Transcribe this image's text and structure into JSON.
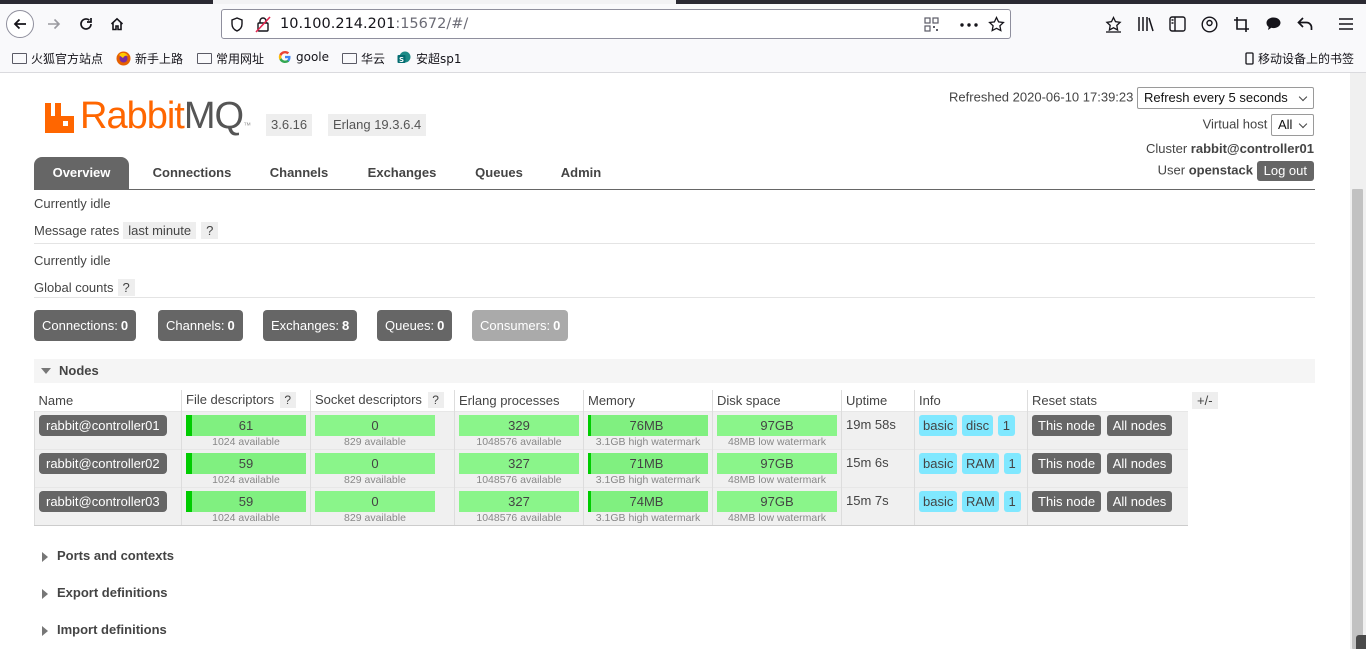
{
  "browser": {
    "url_host": "10.100.214.201",
    "url_rest": ":15672/#/",
    "bookmarks": [
      {
        "label": "火狐官方站点",
        "icon": "folder-icon"
      },
      {
        "label": "新手上路",
        "icon": "firefox-icon"
      },
      {
        "label": "常用网址",
        "icon": "folder-icon"
      },
      {
        "label": "goole",
        "icon": "google-icon"
      },
      {
        "label": "华云",
        "icon": "folder-icon"
      },
      {
        "label": "安超sp1",
        "icon": "sharepoint-icon"
      }
    ],
    "mobile_bookmarks": "移动设备上的书签"
  },
  "header": {
    "logo_rabbit": "Rabbit",
    "logo_mq": "MQ",
    "logo_tm": "™",
    "version": "3.6.16",
    "erlang": "Erlang 19.3.6.4",
    "refreshed_label": "Refreshed",
    "refreshed_value": "2020-06-10 17:39:23",
    "refresh_select": "Refresh every 5 seconds",
    "vhost_label": "Virtual host",
    "vhost_value": "All",
    "cluster_label": "Cluster",
    "cluster_value": "rabbit@controller01",
    "user_label": "User",
    "user_value": "openstack",
    "logout": "Log out"
  },
  "tabs": [
    "Overview",
    "Connections",
    "Channels",
    "Exchanges",
    "Queues",
    "Admin"
  ],
  "overview": {
    "idle1": "Currently idle",
    "message_rates_label": "Message rates",
    "message_rates_value": "last minute",
    "help": "?",
    "idle2": "Currently idle",
    "global_counts_label": "Global counts"
  },
  "counts": [
    {
      "label": "Connections:",
      "value": "0"
    },
    {
      "label": "Channels:",
      "value": "0"
    },
    {
      "label": "Exchanges:",
      "value": "8"
    },
    {
      "label": "Queues:",
      "value": "0"
    },
    {
      "label": "Consumers:",
      "value": "0"
    }
  ],
  "nodes": {
    "title": "Nodes",
    "columns": [
      "Name",
      "File descriptors",
      "Socket descriptors",
      "Erlang processes",
      "Memory",
      "Disk space",
      "Uptime",
      "Info",
      "Reset stats"
    ],
    "plusminus": "+/-",
    "rows": [
      {
        "name": "rabbit@controller01",
        "fd": "61",
        "fd_sub": "1024 available",
        "sd": "0",
        "sd_sub": "829 available",
        "ep": "329",
        "ep_sub": "1048576 available",
        "mem": "76MB",
        "mem_sub": "3.1GB high watermark",
        "disk": "97GB",
        "disk_sub": "48MB low watermark",
        "uptime": "19m 58s",
        "info": [
          "basic",
          "disc",
          "1"
        ],
        "reset_this": "This node",
        "reset_all": "All nodes"
      },
      {
        "name": "rabbit@controller02",
        "fd": "59",
        "fd_sub": "1024 available",
        "sd": "0",
        "sd_sub": "829 available",
        "ep": "327",
        "ep_sub": "1048576 available",
        "mem": "71MB",
        "mem_sub": "3.1GB high watermark",
        "disk": "97GB",
        "disk_sub": "48MB low watermark",
        "uptime": "15m 6s",
        "info": [
          "basic",
          "RAM",
          "1"
        ],
        "reset_this": "This node",
        "reset_all": "All nodes"
      },
      {
        "name": "rabbit@controller03",
        "fd": "59",
        "fd_sub": "1024 available",
        "sd": "0",
        "sd_sub": "829 available",
        "ep": "327",
        "ep_sub": "1048576 available",
        "mem": "74MB",
        "mem_sub": "3.1GB high watermark",
        "disk": "97GB",
        "disk_sub": "48MB low watermark",
        "uptime": "15m 7s",
        "info": [
          "basic",
          "RAM",
          "1"
        ],
        "reset_this": "This node",
        "reset_all": "All nodes"
      }
    ]
  },
  "sections": [
    "Ports and contexts",
    "Export definitions",
    "Import definitions"
  ],
  "colors": {
    "brand": "#ff6600",
    "bar_fill": "#80f080",
    "bar_edge": "#00cc00",
    "tag": "#80e8ff",
    "button": "#666666"
  }
}
